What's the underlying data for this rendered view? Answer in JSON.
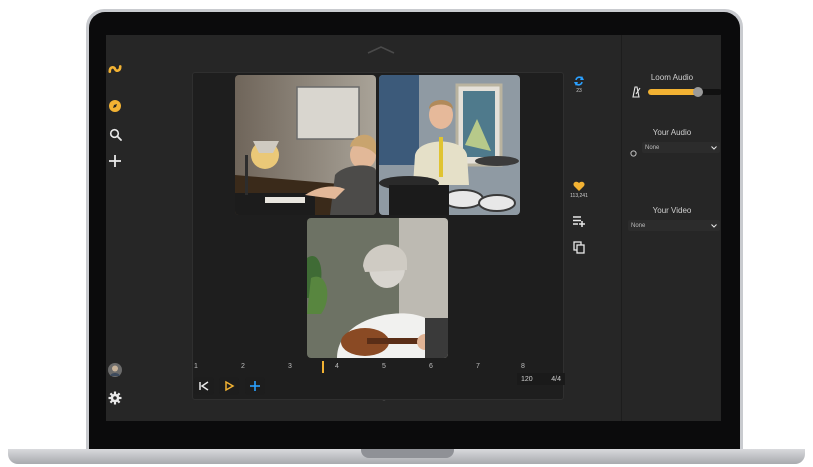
{
  "app": {
    "left_rail": {
      "logo": "loom-logo-icon",
      "items": [
        {
          "icon": "compass-icon"
        },
        {
          "icon": "search-icon"
        },
        {
          "icon": "plus-icon"
        }
      ],
      "bottom": [
        {
          "icon": "avatar"
        },
        {
          "icon": "gear-icon"
        }
      ]
    },
    "stage": {
      "tiles": [
        {
          "label": "Piano player video"
        },
        {
          "label": "Drummer video"
        },
        {
          "label": "Ukulele player video"
        }
      ]
    },
    "timeline": {
      "bars": [
        "1",
        "2",
        "3",
        "4",
        "5",
        "6",
        "7",
        "8"
      ],
      "tempo": "120",
      "time_signature": "4/4"
    },
    "tools": {
      "loop_count": "23",
      "likes_count": "113,241"
    },
    "right_panel": {
      "loom_audio_title": "Loom Audio",
      "loom_audio_level": 0.68,
      "your_audio_title": "Your Audio",
      "your_audio_value": "None",
      "your_video_title": "Your Video",
      "your_video_value": "None"
    },
    "colors": {
      "accent": "#f2b233",
      "blue_accent": "#2aa0ff",
      "background": "#262626"
    }
  }
}
